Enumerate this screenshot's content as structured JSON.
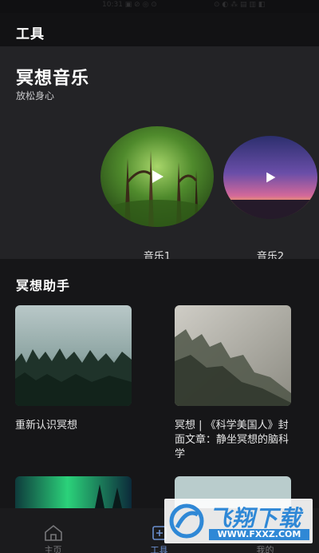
{
  "status_bar": {
    "left_faint": "10:31 ▣ ⊘ ◎ ⊙",
    "right_faint": "⊙ ◐ ⁂ ▤ ▥ ◧"
  },
  "header": {
    "title": "工具"
  },
  "music": {
    "title": "冥想音乐",
    "subtitle": "放松身心",
    "items": [
      {
        "label": "音乐1",
        "art": "forest-green"
      },
      {
        "label": "音乐2",
        "art": "dusk-sky-purple"
      }
    ]
  },
  "assistant": {
    "title": "冥想助手",
    "articles": [
      {
        "title": "重新认识冥想",
        "art": "misty-forest-teal"
      },
      {
        "title": "冥想 | 《科学美国人》封面文章：静坐冥想的脑科学",
        "art": "foggy-hillside-grey"
      },
      {
        "title": "",
        "art": "aurora-green"
      },
      {
        "title": "",
        "art": "pale-sky"
      }
    ]
  },
  "nav": {
    "items": [
      {
        "label": "主页",
        "icon": "home-icon",
        "active": false
      },
      {
        "label": "工具",
        "icon": "tools-icon",
        "active": true
      },
      {
        "label": "我的",
        "icon": "profile-icon",
        "active": false
      }
    ]
  },
  "watermark": {
    "text": "飞翔下载",
    "url": "WWW.FXXZ.COM"
  },
  "colors": {
    "accent": "#6b8fcf",
    "watermark_blue": "#2f88d6",
    "background": "#141416",
    "card_section": "#232326"
  }
}
